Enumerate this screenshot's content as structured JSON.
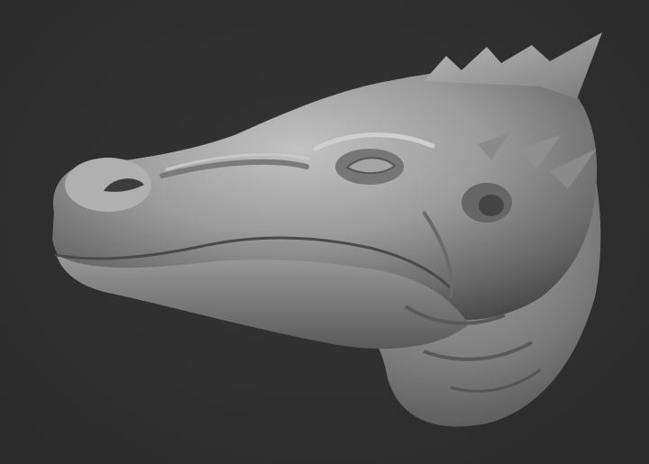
{
  "scene": {
    "subject_icon": "dragon-head-sculpt-icon",
    "colors": {
      "background": "#2e2e2e",
      "clay_light": "#b9b9b9",
      "clay_mid": "#8e8e8e",
      "clay_dark": "#4a4a4a"
    }
  }
}
